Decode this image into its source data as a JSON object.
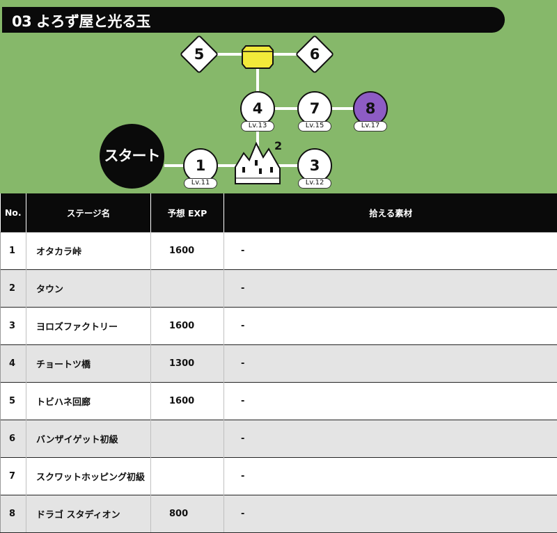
{
  "title": "03 よろず屋と光る玉",
  "map": {
    "start_label": "スタート",
    "nodes": [
      {
        "num": "1",
        "lv": "Lv.11"
      },
      {
        "num": "3",
        "lv": "Lv.12"
      },
      {
        "num": "4",
        "lv": "Lv.13"
      },
      {
        "num": "7",
        "lv": "Lv.15"
      },
      {
        "num": "8",
        "lv": "Lv.17"
      }
    ],
    "diamonds": [
      "5",
      "6"
    ],
    "town_num": "2",
    "colors": {
      "field": "#86b86a",
      "highlight_node": "#8d5cc4",
      "shop": "#f2ea3a"
    }
  },
  "table": {
    "headers": [
      "No.",
      "ステージ名",
      "予想 EXP",
      "拾える素材"
    ],
    "rows": [
      {
        "no": "1",
        "name": "オタカラ峠",
        "exp": "1600",
        "mat": "-"
      },
      {
        "no": "2",
        "name": "タウン",
        "exp": "",
        "mat": "-"
      },
      {
        "no": "3",
        "name": "ヨロズファクトリー",
        "exp": "1600",
        "mat": "-"
      },
      {
        "no": "4",
        "name": "チョートツ橋",
        "exp": "1300",
        "mat": "-"
      },
      {
        "no": "5",
        "name": "トビハネ回廊",
        "exp": "1600",
        "mat": "-"
      },
      {
        "no": "6",
        "name": "バンザイゲット初級",
        "exp": "",
        "mat": "-"
      },
      {
        "no": "7",
        "name": "スクワットホッピング初級",
        "exp": "",
        "mat": "-"
      },
      {
        "no": "8",
        "name": "ドラゴ スタディオン",
        "exp": "800",
        "mat": "-"
      }
    ]
  }
}
